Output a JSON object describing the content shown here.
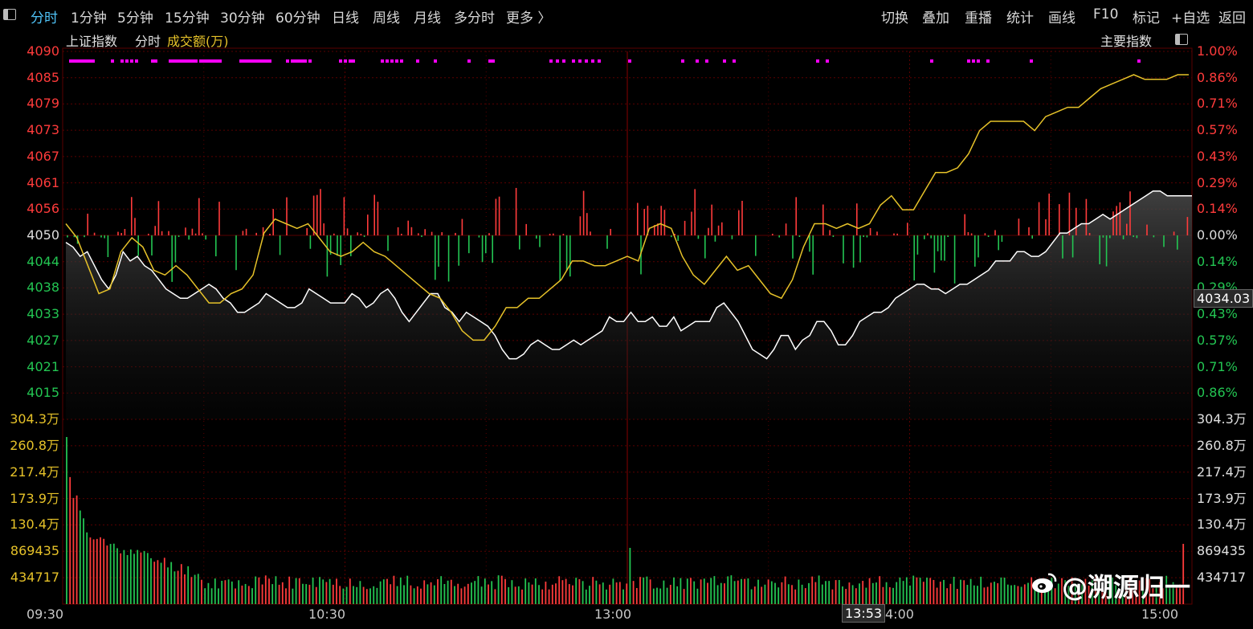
{
  "toolbar": {
    "tabs": [
      "分时",
      "1分钟",
      "5分钟",
      "15分钟",
      "30分钟",
      "60分钟",
      "日线",
      "周线",
      "月线",
      "多分时",
      "更多 〉"
    ],
    "active_tab": "分时",
    "right": [
      "切换",
      "叠加",
      "重播",
      "统计",
      "画线",
      "F10",
      "标记",
      "+自选",
      "返回"
    ]
  },
  "subheader": {
    "index_name": "上证指数",
    "mode": "分时",
    "volume_label": "成交额(万)",
    "right_label": "主要指数"
  },
  "price_axis": {
    "labels": [
      "4090",
      "4085",
      "4079",
      "4073",
      "4067",
      "4061",
      "4056",
      "4050",
      "4044",
      "4038",
      "4033",
      "4027",
      "4021",
      "4015"
    ],
    "pct_labels": [
      "1.00%",
      "0.86%",
      "0.71%",
      "0.57%",
      "0.43%",
      "0.29%",
      "0.14%",
      "0.00%",
      "0.14%",
      "0.29%",
      "0.43%",
      "0.57%",
      "0.71%",
      "0.86%"
    ],
    "prev_close": 4050,
    "current_price_label": "4034.03"
  },
  "volume_axis": {
    "labels": [
      "304.3万",
      "260.8万",
      "217.4万",
      "173.9万",
      "130.4万",
      "869435",
      "434717"
    ]
  },
  "time_axis": {
    "labels": [
      "09:30",
      "10:30",
      "13:00",
      "4:00",
      "15:00"
    ],
    "cursor_time": "13:53"
  },
  "watermark": {
    "text": "@溯源归一"
  },
  "colors": {
    "up": "#ff3b3b",
    "down": "#23c552",
    "price_line": "#ffffff",
    "avg_line": "#e6c229",
    "grid": "#5a0000",
    "accent": "#4fc3f7",
    "marker": "#ff00ff"
  },
  "chart_data": {
    "type": "line",
    "title": "上证指数 分时",
    "series": [
      {
        "name": "price",
        "values": [
          4051,
          4050,
          4048,
          4049,
          4046,
          4043,
          4041,
          4044,
          4049,
          4047,
          4048,
          4046,
          4045,
          4043,
          4041,
          4040,
          4039,
          4039,
          4040,
          4041,
          4042,
          4041,
          4039,
          4038,
          4036,
          4036,
          4037,
          4038,
          4040,
          4039,
          4038,
          4037,
          4037,
          4038,
          4041,
          4040,
          4039,
          4038,
          4038,
          4038,
          4040,
          4039,
          4037,
          4038,
          4040,
          4041,
          4039,
          4036,
          4034,
          4036,
          4038,
          4040,
          4040,
          4037,
          4036,
          4034,
          4036,
          4035,
          4034,
          4033,
          4031,
          4028,
          4026,
          4026,
          4027,
          4029,
          4030,
          4029,
          4028,
          4028,
          4029,
          4030,
          4029,
          4030,
          4031,
          4032,
          4035,
          4034,
          4034,
          4036,
          4034,
          4034,
          4035,
          4033,
          4033,
          4035,
          4032,
          4033,
          4034,
          4034,
          4034,
          4037,
          4038,
          4036,
          4034,
          4031,
          4028,
          4027,
          4026,
          4028,
          4031,
          4031,
          4028,
          4030,
          4031,
          4034,
          4034,
          4032,
          4029,
          4029,
          4031,
          4034,
          4035,
          4036,
          4036,
          4037,
          4039,
          4040,
          4041,
          4042,
          4042,
          4041,
          4041,
          4040,
          4041,
          4042,
          4042,
          4043,
          4044,
          4045,
          4047,
          4047,
          4047,
          4049,
          4049,
          4048,
          4048,
          4049,
          4051,
          4053,
          4053,
          4054,
          4055,
          4055,
          4056,
          4057,
          4056,
          4057,
          4058,
          4059,
          4060,
          4061,
          4062,
          4062,
          4061,
          4061,
          4061,
          4061
        ]
      },
      {
        "name": "avg",
        "values": [
          4055,
          4052,
          4046,
          4040,
          4041,
          4049,
          4052,
          4050,
          4045,
          4044,
          4046,
          4044,
          4041,
          4038,
          4038,
          4040,
          4041,
          4044,
          4053,
          4056,
          4055,
          4054,
          4055,
          4052,
          4049,
          4048,
          4049,
          4051,
          4049,
          4048,
          4046,
          4044,
          4042,
          4040,
          4039,
          4036,
          4032,
          4030,
          4030,
          4033,
          4037,
          4037,
          4039,
          4039,
          4041,
          4043,
          4047,
          4047,
          4046,
          4046,
          4047,
          4048,
          4047,
          4054,
          4055,
          4054,
          4048,
          4044,
          4042,
          4045,
          4048,
          4045,
          4046,
          4043,
          4040,
          4039,
          4043,
          4050,
          4055,
          4055,
          4054,
          4055,
          4054,
          4055,
          4059,
          4061,
          4058,
          4058,
          4062,
          4066,
          4066,
          4067,
          4070,
          4075,
          4077,
          4077,
          4077,
          4077,
          4075,
          4078,
          4079,
          4080,
          4080,
          4082,
          4084,
          4085,
          4086,
          4087,
          4086,
          4086,
          4086,
          4087,
          4087
        ]
      }
    ],
    "ylim": [
      4013,
      4092
    ]
  }
}
